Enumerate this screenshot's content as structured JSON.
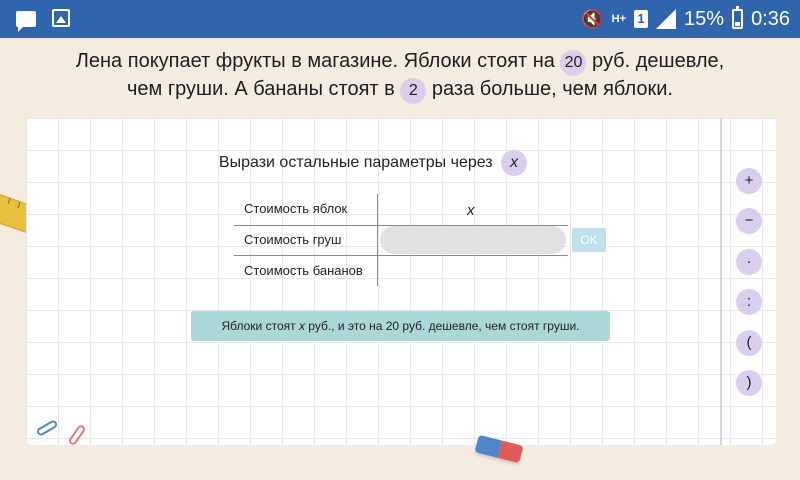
{
  "status_bar": {
    "signal_label": "H+",
    "sim_label": "1",
    "battery": "15%",
    "time": "0:36"
  },
  "problem": {
    "part1": "Лена покупает фрукты в магазине. Яблоки стоят на",
    "num1": "20",
    "part2": "руб. дешевле,",
    "part3": "чем груши. А бананы стоят в",
    "num2": "2",
    "part4": "раза больше, чем яблоки."
  },
  "task": {
    "title": "Вырази остальные параметры через",
    "variable": "x"
  },
  "table": {
    "rows": [
      {
        "label": "Стоимость яблок",
        "value": "x"
      },
      {
        "label": "Стоимость груш",
        "value": ""
      },
      {
        "label": "Стоимость бананов",
        "value": ""
      }
    ],
    "ok_label": "OK"
  },
  "hint": {
    "before": "Яблоки стоят ",
    "var": "x",
    "after": " руб., и это на 20 руб. дешевле, чем стоят груши."
  },
  "keypad": [
    "+",
    "−",
    "·",
    ":",
    "(",
    ")"
  ],
  "colors": {
    "status_bar": "#2f65ad",
    "background": "#f3ecdf",
    "badge": "#d9ceee",
    "hint": "#a9d8d6",
    "ok_button": "#bfe1ee"
  }
}
